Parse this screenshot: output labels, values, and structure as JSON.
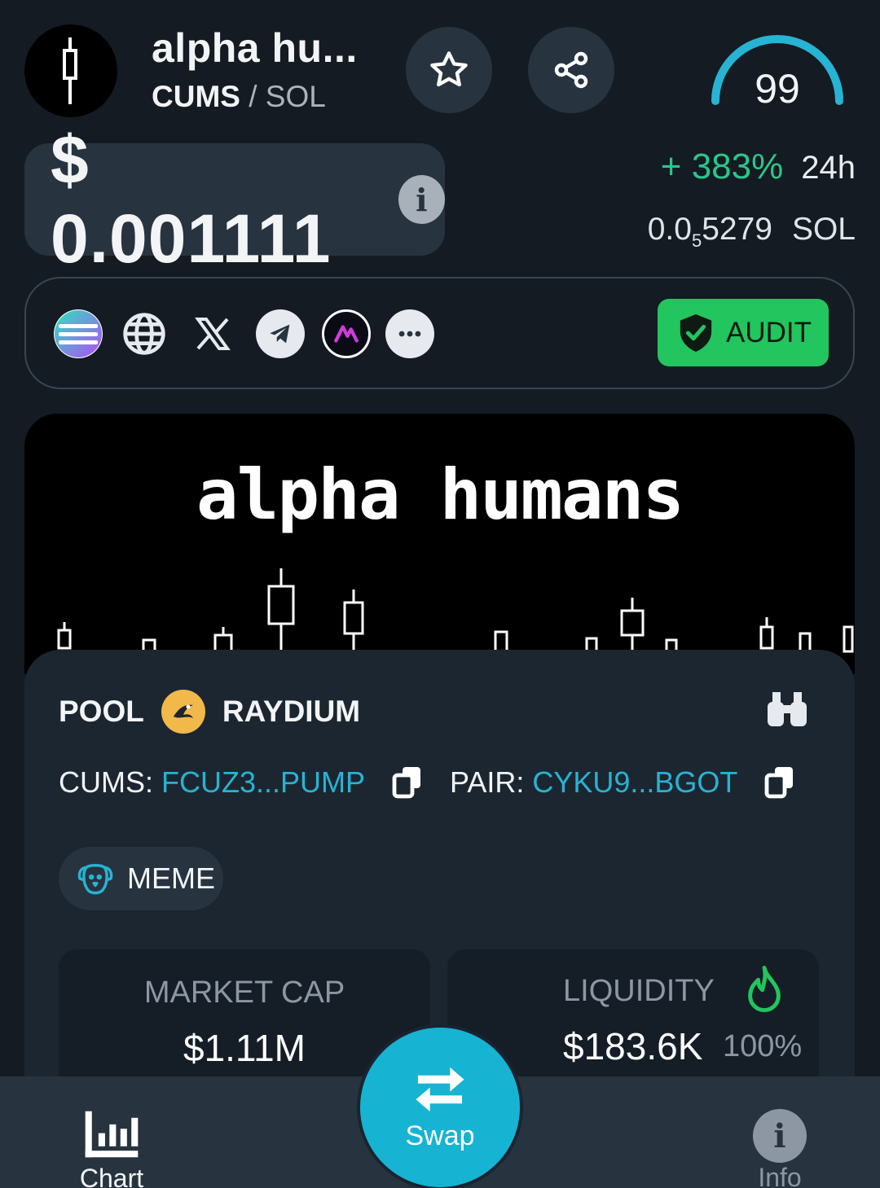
{
  "header": {
    "token_name": "alpha hu...",
    "symbol": "CUMS",
    "separator": "/",
    "quote": "SOL",
    "score": "99",
    "favorite_icon": "star-icon",
    "share_icon": "share-icon"
  },
  "price": {
    "usd": "$ 0.001111",
    "change": "+ 383%",
    "change_period": "24h",
    "sol_prefix": "0.0",
    "sol_sub": "5",
    "sol_suffix": "5279",
    "sol_unit": "SOL",
    "change_color": "#2bc58a"
  },
  "socials": [
    "solana-icon",
    "globe-icon",
    "x-icon",
    "telegram-icon",
    "moonshot-icon",
    "more-icon"
  ],
  "audit": {
    "label": "AUDIT",
    "color": "#22c55e"
  },
  "banner": {
    "title": "alpha humans"
  },
  "pool": {
    "label": "POOL",
    "dex": "RAYDIUM",
    "token_label": "CUMS:",
    "token_address": "FCUZ3...PUMP",
    "pair_label": "PAIR:",
    "pair_address": "CYKU9...BGOT",
    "accent": "#27b3d3"
  },
  "tag": {
    "label": "MEME"
  },
  "stats": {
    "market_cap_label": "MARKET CAP",
    "market_cap_value": "$1.11M",
    "liquidity_label": "LIQUIDITY",
    "liquidity_value": "$183.6K",
    "liquidity_pct": "100%"
  },
  "nav": {
    "chart": "Chart",
    "swap": "Swap",
    "info": "Info"
  }
}
